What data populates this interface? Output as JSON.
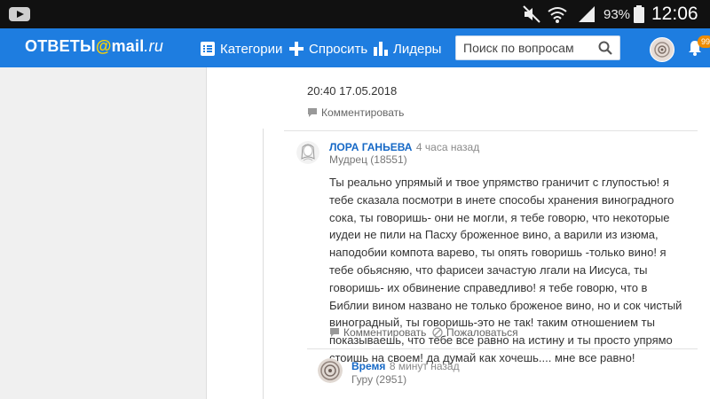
{
  "status_bar": {
    "battery": "93%",
    "clock": "12:06"
  },
  "header": {
    "logo_prefix": "ОТВЕТЫ",
    "logo_at": "@",
    "logo_mail": "mail",
    "logo_ru": ".ru",
    "nav": {
      "categories": "Категории",
      "ask": "Спросить",
      "leaders": "Лидеры"
    },
    "search_placeholder": "Поиск по вопросам",
    "notification_count": "99"
  },
  "previous_answer": {
    "timestamp": "20:40 17.05.2018",
    "comment_label": "Комментировать"
  },
  "comment_1": {
    "author": "ЛОРА ГАНЬЕВА",
    "time_ago": "4 часа назад",
    "rank": "Мудрец (18551)",
    "text": "Ты реально упрямый и твое упрямство граничит с глупостью! я тебе сказала посмотри в инете способы хранения виноградного сока, ты говоришь- они не могли, я тебе говорю, что некоторые иудеи не пили на Пасху броженное вино, а варили из изюма, наподобии компота варево, ты опять говоришь -только вино! я тебе обьясняю, что фарисеи зачастую лгали на Иисуса, ты говоришь- их обвинение справедливо! я тебе говорю, что в Библии вином названо не только броженое вино, но и сок чистый виноградный, ты говоришь-это не так! таким отношением ты показываешь, что тебе все равно на истину и ты просто упрямо стоишь на своем! да думай как хочешь.... мне все равно!",
    "comment_label": "Комментировать",
    "report_label": "Пожаловаться"
  },
  "comment_2": {
    "author": "Время",
    "time_ago": "8 минут назад",
    "rank": "Гуру (2951)"
  },
  "colors": {
    "header_bg": "#1e7de0",
    "link": "#1568c6",
    "badge": "#f08c00"
  }
}
